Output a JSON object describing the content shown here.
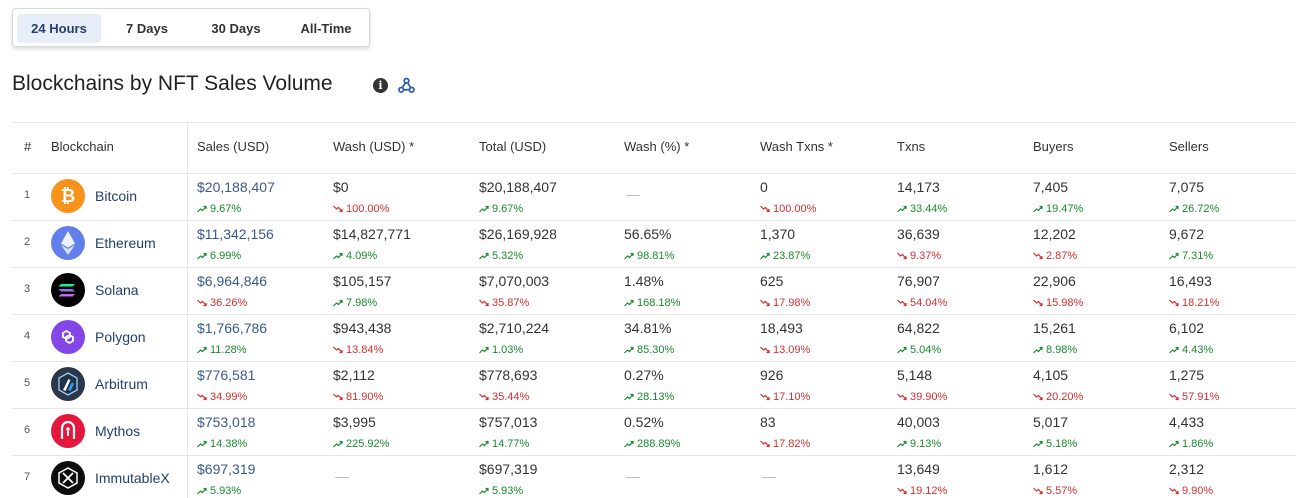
{
  "tabs": [
    "24 Hours",
    "7 Days",
    "30 Days",
    "All-Time"
  ],
  "active_tab": 0,
  "title": "Blockchains by NFT Sales Volume",
  "info_symbol": "i",
  "headers": [
    "#",
    "Blockchain",
    "Sales (USD)",
    "Wash (USD) *",
    "Total (USD)",
    "Wash (%) *",
    "Wash Txns *",
    "Txns",
    "Buyers",
    "Sellers"
  ],
  "dash": "—",
  "colors": {
    "up": "#1a8a2e",
    "down": "#d32f2f",
    "link": "#3a5a8c",
    "name": "#23416b"
  },
  "rows": [
    {
      "idx": "1",
      "name": "Bitcoin",
      "logo": "bitcoin-logo-icon",
      "sales": [
        "$20,188,407",
        "up",
        "9.67%"
      ],
      "wash": [
        "$0",
        "down",
        "100.00%"
      ],
      "total": [
        "$20,188,407",
        "up",
        "9.67%"
      ],
      "wash_pct": null,
      "wash_txns": [
        "0",
        "down",
        "100.00%"
      ],
      "txns": [
        "14,173",
        "up",
        "33.44%"
      ],
      "buyers": [
        "7,405",
        "up",
        "19.47%"
      ],
      "sellers": [
        "7,075",
        "up",
        "26.72%"
      ]
    },
    {
      "idx": "2",
      "name": "Ethereum",
      "logo": "ethereum-logo-icon",
      "sales": [
        "$11,342,156",
        "up",
        "6.99%"
      ],
      "wash": [
        "$14,827,771",
        "up",
        "4.09%"
      ],
      "total": [
        "$26,169,928",
        "up",
        "5.32%"
      ],
      "wash_pct": [
        "56.65%",
        "up",
        "98.81%"
      ],
      "wash_txns": [
        "1,370",
        "up",
        "23.87%"
      ],
      "txns": [
        "36,639",
        "down",
        "9.37%"
      ],
      "buyers": [
        "12,202",
        "down",
        "2.87%"
      ],
      "sellers": [
        "9,672",
        "up",
        "7.31%"
      ]
    },
    {
      "idx": "3",
      "name": "Solana",
      "logo": "solana-logo-icon",
      "sales": [
        "$6,964,846",
        "down",
        "36.26%"
      ],
      "wash": [
        "$105,157",
        "up",
        "7.98%"
      ],
      "total": [
        "$7,070,003",
        "down",
        "35.87%"
      ],
      "wash_pct": [
        "1.48%",
        "up",
        "168.18%"
      ],
      "wash_txns": [
        "625",
        "down",
        "17.98%"
      ],
      "txns": [
        "76,907",
        "down",
        "54.04%"
      ],
      "buyers": [
        "22,906",
        "down",
        "15.98%"
      ],
      "sellers": [
        "16,493",
        "down",
        "18.21%"
      ]
    },
    {
      "idx": "4",
      "name": "Polygon",
      "logo": "polygon-logo-icon",
      "sales": [
        "$1,766,786",
        "up",
        "11.28%"
      ],
      "wash": [
        "$943,438",
        "down",
        "13.84%"
      ],
      "total": [
        "$2,710,224",
        "up",
        "1.03%"
      ],
      "wash_pct": [
        "34.81%",
        "up",
        "85.30%"
      ],
      "wash_txns": [
        "18,493",
        "down",
        "13.09%"
      ],
      "txns": [
        "64,822",
        "up",
        "5.04%"
      ],
      "buyers": [
        "15,261",
        "up",
        "8.98%"
      ],
      "sellers": [
        "6,102",
        "up",
        "4.43%"
      ]
    },
    {
      "idx": "5",
      "name": "Arbitrum",
      "logo": "arbitrum-logo-icon",
      "sales": [
        "$776,581",
        "down",
        "34.99%"
      ],
      "wash": [
        "$2,112",
        "down",
        "81.90%"
      ],
      "total": [
        "$778,693",
        "down",
        "35.44%"
      ],
      "wash_pct": [
        "0.27%",
        "up",
        "28.13%"
      ],
      "wash_txns": [
        "926",
        "down",
        "17.10%"
      ],
      "txns": [
        "5,148",
        "down",
        "39.90%"
      ],
      "buyers": [
        "4,105",
        "down",
        "20.20%"
      ],
      "sellers": [
        "1,275",
        "down",
        "57.91%"
      ]
    },
    {
      "idx": "6",
      "name": "Mythos",
      "logo": "mythos-logo-icon",
      "sales": [
        "$753,018",
        "up",
        "14.38%"
      ],
      "wash": [
        "$3,995",
        "up",
        "225.92%"
      ],
      "total": [
        "$757,013",
        "up",
        "14.77%"
      ],
      "wash_pct": [
        "0.52%",
        "up",
        "288.89%"
      ],
      "wash_txns": [
        "83",
        "down",
        "17.82%"
      ],
      "txns": [
        "40,003",
        "up",
        "9.13%"
      ],
      "buyers": [
        "5,017",
        "up",
        "5.18%"
      ],
      "sellers": [
        "4,433",
        "up",
        "1.86%"
      ]
    },
    {
      "idx": "7",
      "name": "ImmutableX",
      "logo": "immutablex-logo-icon",
      "sales": [
        "$697,319",
        "up",
        "5.93%"
      ],
      "wash": null,
      "total": [
        "$697,319",
        "up",
        "5.93%"
      ],
      "wash_pct": null,
      "wash_txns": null,
      "txns": [
        "13,649",
        "down",
        "19.12%"
      ],
      "buyers": [
        "1,612",
        "down",
        "5.57%"
      ],
      "sellers": [
        "2,312",
        "down",
        "9.90%"
      ]
    }
  ]
}
